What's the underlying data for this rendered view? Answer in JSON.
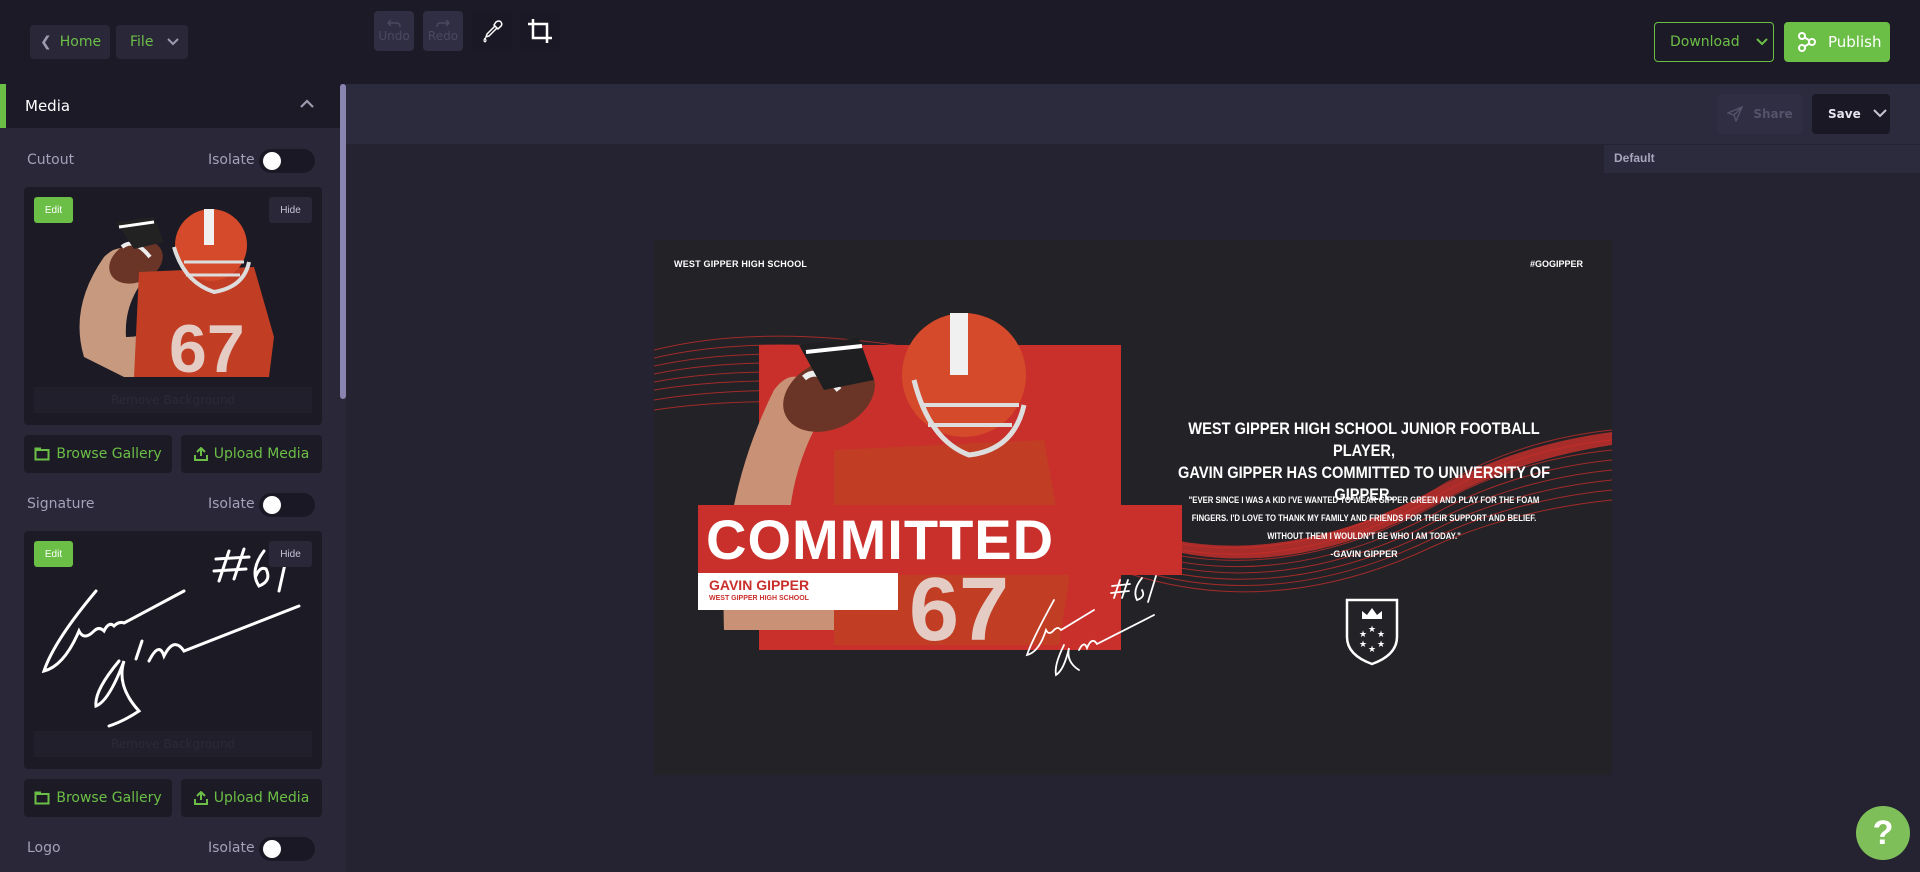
{
  "topbar": {
    "home_label": "Home",
    "file_label": "File",
    "download_label": "Download",
    "publish_label": "Publish"
  },
  "sidebar": {
    "section_title": "Media",
    "isolate_label": "Isolate",
    "items": [
      {
        "label": "Cutout",
        "isolate_on": false,
        "edit_label": "Edit",
        "hide_label": "Hide",
        "remove_bg_label": "Remove Background",
        "browse_label": "Browse Gallery",
        "upload_label": "Upload Media"
      },
      {
        "label": "Signature",
        "isolate_on": false,
        "edit_label": "Edit",
        "hide_label": "Hide",
        "remove_bg_label": "Remove Background",
        "browse_label": "Browse Gallery",
        "upload_label": "Upload Media"
      },
      {
        "label": "Logo",
        "isolate_on": false
      }
    ]
  },
  "toolbar": {
    "undo_label": "Undo",
    "redo_label": "Redo",
    "share_label": "Share",
    "save_label": "Save",
    "layer_label": "Default"
  },
  "canvas": {
    "school_top": "WEST GIPPER HIGH SCHOOL",
    "hashtag": "#GOGIPPER",
    "committed": "COMMITTED",
    "player_name": "GAVIN GIPPER",
    "player_school": "WEST GIPPER HIGH SCHOOL",
    "headline_line1": "WEST GIPPER HIGH SCHOOL JUNIOR FOOTBALL PLAYER,",
    "headline_line2": "GAVIN GIPPER HAS COMMITTED TO UNIVERSITY OF GIPPER.",
    "quote": "\"EVER SINCE I WAS A KID I'VE WANTED TO WEAR GIPPER GREEN AND PLAY FOR THE FOAM FINGERS. I'D LOVE TO THANK MY FAMILY AND FRIENDS FOR THEIR SUPPORT AND BELIEF. WITHOUT THEM I WOULDN'T BE WHO I AM TODAY.\"",
    "quote_author": "-GAVIN GIPPER",
    "signature_text": "Gavin Gipper #67",
    "jersey_number": "67"
  },
  "colors": {
    "accent_green": "#6cbf46",
    "brand_red": "#c9302c",
    "background": "#1c1a26"
  },
  "help": {
    "label": "?"
  }
}
